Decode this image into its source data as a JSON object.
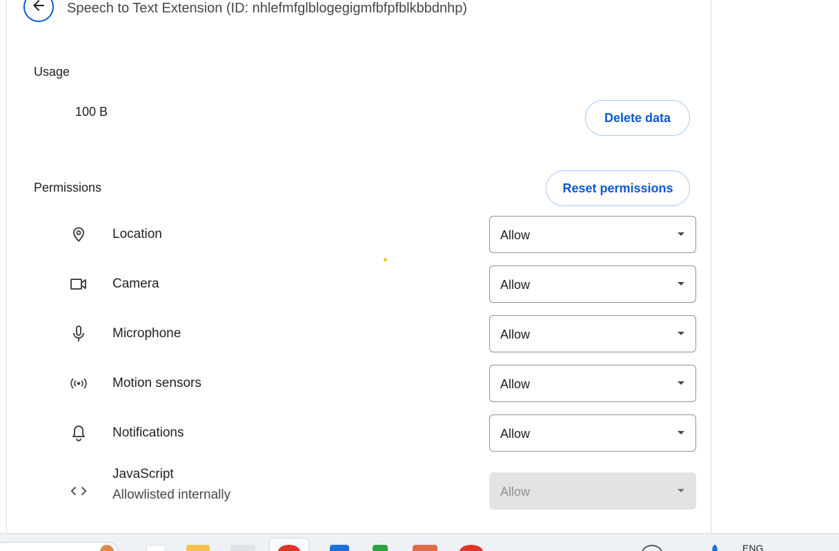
{
  "header": {
    "back_icon": "arrow-left-icon",
    "title": "Speech to Text Extension (ID: nhlefmfglblogegigmfbfpfblkbbdnhp)"
  },
  "usage": {
    "heading": "Usage",
    "value": "100 B",
    "delete_label": "Delete data"
  },
  "permissions": {
    "heading": "Permissions",
    "reset_label": "Reset permissions",
    "items": [
      {
        "label": "Location",
        "icon": "location-pin-icon",
        "value": "Allow",
        "enabled": true
      },
      {
        "label": "Camera",
        "icon": "camera-icon",
        "value": "Allow",
        "enabled": true
      },
      {
        "label": "Microphone",
        "icon": "microphone-icon",
        "value": "Allow",
        "enabled": true
      },
      {
        "label": "Motion sensors",
        "icon": "motion-sensors-icon",
        "value": "Allow",
        "enabled": true
      },
      {
        "label": "Notifications",
        "icon": "bell-icon",
        "value": "Allow",
        "enabled": true
      },
      {
        "label": "JavaScript",
        "sublabel": "Allowlisted internally",
        "icon": "code-icon",
        "value": "Allow",
        "enabled": false
      }
    ]
  },
  "taskbar": {
    "language": "ENG"
  },
  "colors": {
    "accent": "#0b57d0",
    "button_border": "#a8c7fa",
    "disabled_fill": "#e3e3e3",
    "text_primary": "#1f1f1f",
    "text_secondary": "#444746"
  }
}
